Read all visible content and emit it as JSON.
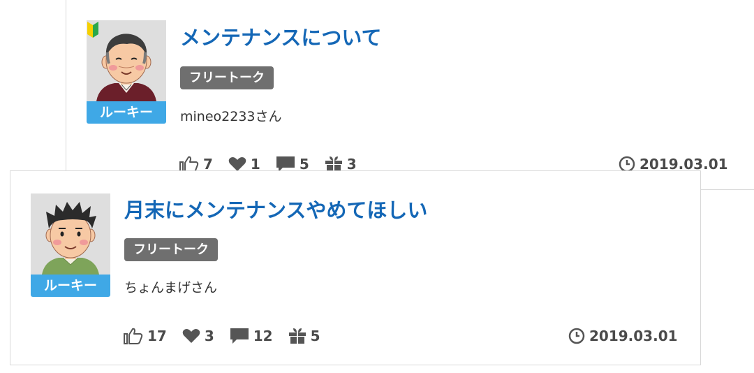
{
  "posts": [
    {
      "title": "メンテナンスについて",
      "tag": "フリートーク",
      "author": "mineo2233さん",
      "rank": "ルーキー",
      "beginner_badge": true,
      "avatar_icon": "elderly-man-avatar",
      "stats": {
        "likes": "7",
        "hearts": "1",
        "comments": "5",
        "gifts": "3"
      },
      "date": "2019.03.01"
    },
    {
      "title": "月末にメンテナンスやめてほしい",
      "tag": "フリートーク",
      "author": "ちょんまげさん",
      "rank": "ルーキー",
      "beginner_badge": false,
      "avatar_icon": "young-man-avatar",
      "stats": {
        "likes": "17",
        "hearts": "3",
        "comments": "12",
        "gifts": "5"
      },
      "date": "2019.03.01"
    }
  ],
  "colors": {
    "title": "#1467b6",
    "tag_bg": "#6f6f6f",
    "rank_bg": "#3fa8e6",
    "stat_text": "#4a4a4a"
  }
}
